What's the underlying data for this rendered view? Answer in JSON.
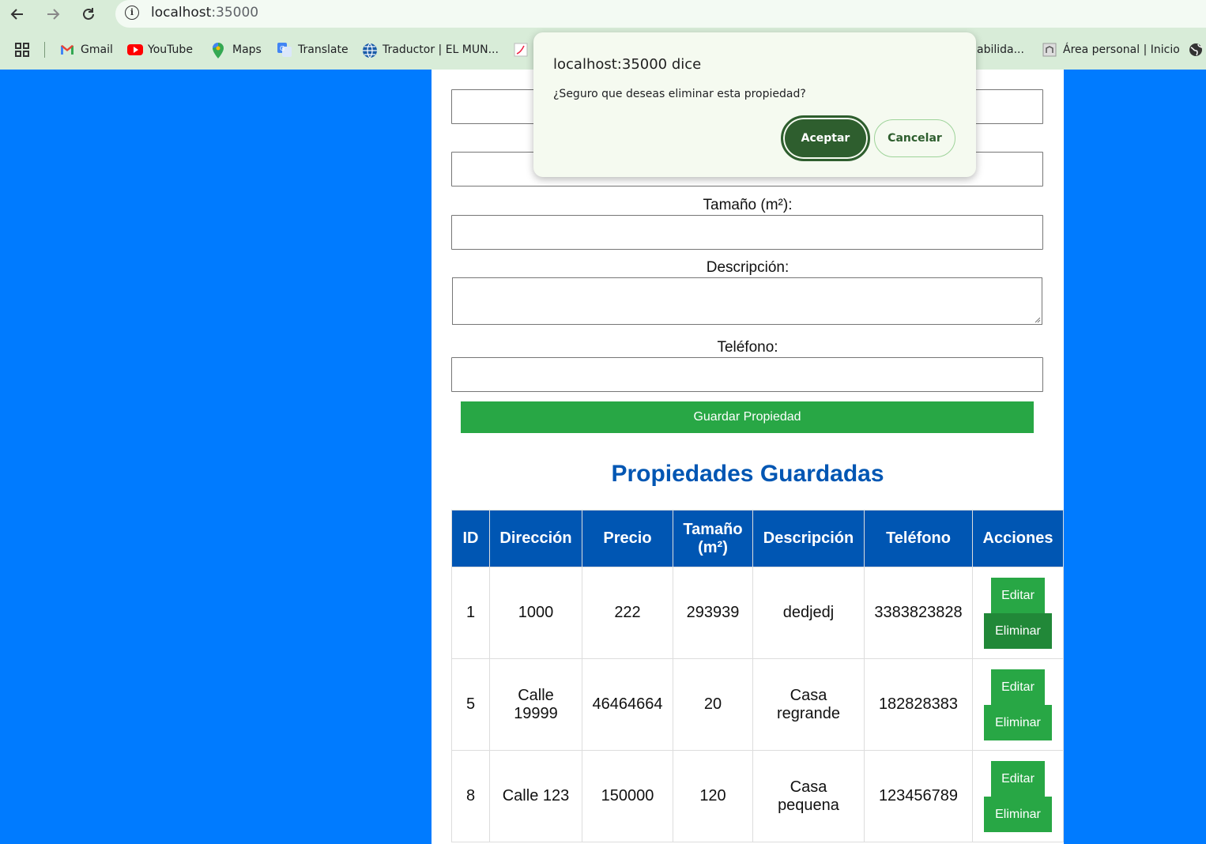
{
  "browser": {
    "url_host": "localhost",
    "url_port": ":35000",
    "bookmarks": [
      {
        "label": "Gmail",
        "icon": "gmail-icon"
      },
      {
        "label": "YouTube",
        "icon": "youtube-icon"
      },
      {
        "label": "Maps",
        "icon": "maps-icon"
      },
      {
        "label": "Translate",
        "icon": "translate-icon"
      },
      {
        "label": "Traductor | EL MUN...",
        "icon": "globe-icon"
      },
      {
        "label": "abilida...",
        "icon": "page-icon"
      },
      {
        "label": "Área personal | Inicio",
        "icon": "moodle-icon"
      }
    ]
  },
  "form": {
    "size_label": "Tamaño (m²):",
    "description_label": "Descripción:",
    "phone_label": "Teléfono:",
    "save_label": "Guardar Propiedad"
  },
  "list": {
    "title": "Propiedades Guardadas",
    "headers": [
      "ID",
      "Dirección",
      "Precio",
      "Tamaño (m²)",
      "Descripción",
      "Teléfono",
      "Acciones"
    ],
    "rows": [
      {
        "id": "1",
        "address": "1000",
        "price": "222",
        "size": "293939",
        "description": "dedjedj",
        "phone": "3383823828"
      },
      {
        "id": "5",
        "address": "Calle 19999",
        "price": "46464664",
        "size": "20",
        "description": "Casa regrande",
        "phone": "182828383"
      },
      {
        "id": "8",
        "address": "Calle 123",
        "price": "150000",
        "size": "120",
        "description": "Casa pequena",
        "phone": "123456789"
      }
    ],
    "edit_label": "Editar",
    "delete_label": "Eliminar"
  },
  "dialog": {
    "title": "localhost:35000 dice",
    "message": "¿Seguro que deseas eliminar esta propiedad?",
    "ok_label": "Aceptar",
    "cancel_label": "Cancelar"
  },
  "colors": {
    "page_bg": "#007bff",
    "primary_blue": "#0056b3",
    "button_green": "#28a745",
    "dialog_bg": "#f5faf0",
    "dialog_accent": "#2e5e2e"
  }
}
